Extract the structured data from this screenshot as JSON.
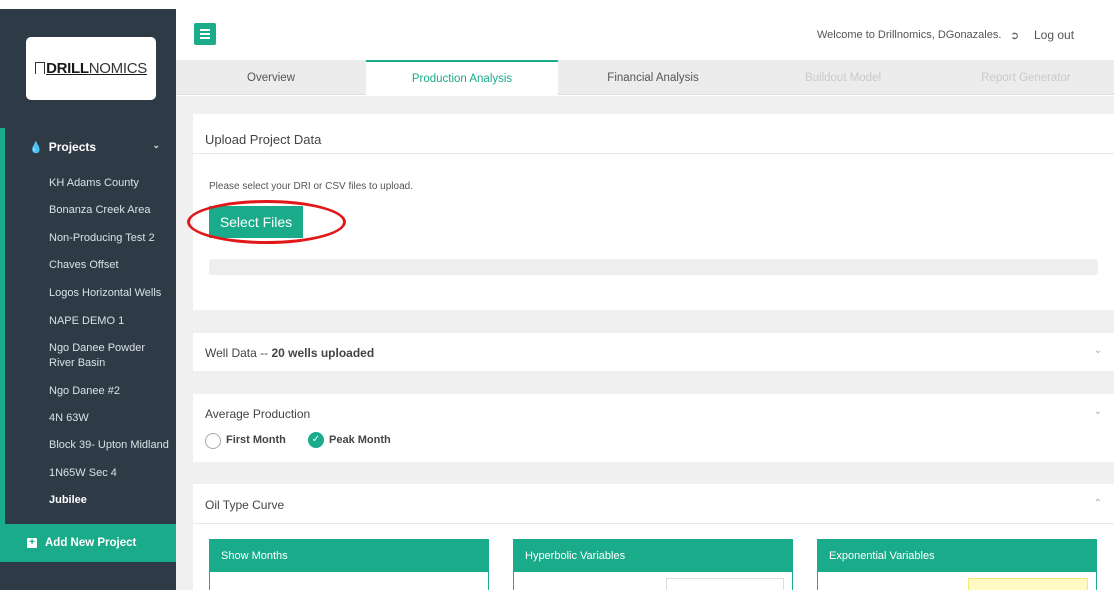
{
  "brand": {
    "logo_text_a": "DRILL",
    "logo_text_b": "NOMICS"
  },
  "sidebar": {
    "projects_label": "Projects",
    "projects": [
      "KH Adams County",
      "Bonanza Creek Area",
      "Non-Producing Test 2",
      "Chaves Offset",
      "Logos Horizontal Wells",
      "NAPE DEMO 1",
      "Ngo Danee Powder River Basin",
      "Ngo Danee #2",
      "4N 63W",
      "Block 39- Upton Midland",
      "1N65W Sec 4",
      "Jubilee"
    ],
    "active_project": "Jubilee",
    "add_project_label": "Add New Project"
  },
  "header": {
    "welcome": "Welcome to Drillnomics, DGonazales.",
    "logout": "Log out"
  },
  "tabs": [
    {
      "label": "Overview",
      "state": "normal"
    },
    {
      "label": "Production Analysis",
      "state": "active"
    },
    {
      "label": "Financial Analysis",
      "state": "normal"
    },
    {
      "label": "Buildout Model",
      "state": "disabled"
    },
    {
      "label": "Report Generator",
      "state": "disabled"
    }
  ],
  "upload": {
    "title": "Upload Project Data",
    "note": "Please select your DRI or CSV files to upload.",
    "button": "Select Files"
  },
  "well_data": {
    "title_prefix": "Well Data -- ",
    "title_bold": "20 wells uploaded"
  },
  "average_production": {
    "title": "Average Production",
    "options": [
      {
        "label": "First Month",
        "checked": false
      },
      {
        "label": "Peak Month",
        "checked": true
      }
    ]
  },
  "oil_type_curve": {
    "title": "Oil Type Curve",
    "panels": [
      "Show Months",
      "Hyperbolic Variables",
      "Exponential Variables"
    ]
  },
  "colors": {
    "accent": "#1aab8a",
    "sidebar": "#2e3a45",
    "highlight": "#e21818"
  }
}
